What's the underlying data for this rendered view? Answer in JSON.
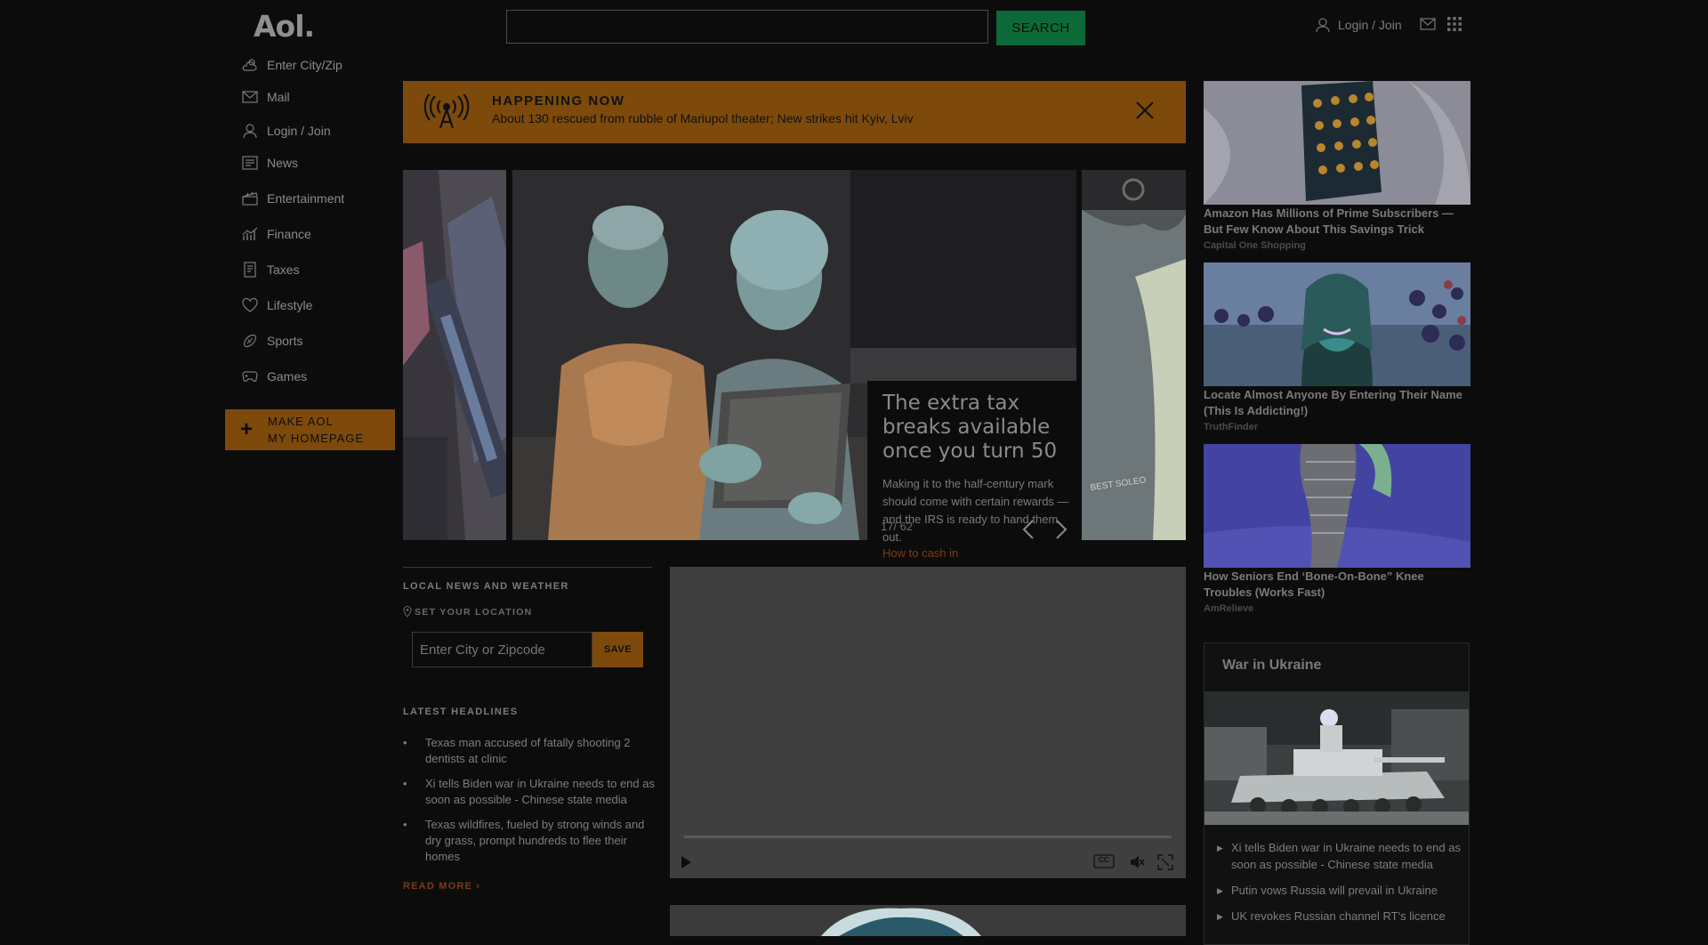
{
  "header": {
    "logo": "Aol.",
    "search_placeholder": "",
    "search_button": "SEARCH",
    "login": "Login / Join"
  },
  "sidebar": {
    "items": [
      {
        "label": "Enter City/Zip",
        "icon": "weather-icon"
      },
      {
        "label": "Mail",
        "icon": "mail-icon"
      },
      {
        "label": "Login / Join",
        "icon": "user-icon"
      },
      {
        "label": "News",
        "icon": "news-icon"
      },
      {
        "label": "Entertainment",
        "icon": "clapper-icon"
      },
      {
        "label": "Finance",
        "icon": "finance-chart-icon"
      },
      {
        "label": "Taxes",
        "icon": "taxes-icon"
      },
      {
        "label": "Lifestyle",
        "icon": "heart-icon"
      },
      {
        "label": "Sports",
        "icon": "football-icon"
      },
      {
        "label": "Games",
        "icon": "gamepad-icon"
      }
    ],
    "make_homepage_line1": "MAKE AOL",
    "make_homepage_line2": "MY HOMEPAGE"
  },
  "banner": {
    "tag": "HAPPENING NOW",
    "text": "About 130 rescued from rubble of Mariupol theater; New strikes hit Kyiv, Lviv"
  },
  "carousel": {
    "title": "The extra tax breaks available once you turn 50",
    "description": "Making it to the half-century mark should come with certain rewards —and the IRS is ready to hand them out.",
    "link": "How to cash in",
    "counter": "17/ 62"
  },
  "local": {
    "heading": "LOCAL NEWS AND WEATHER",
    "set_location": "SET YOUR LOCATION",
    "zip_placeholder": "Enter City or Zipcode",
    "save": "SAVE",
    "latest_heading": "LATEST HEADLINES",
    "headlines": [
      "Texas man accused of fatally shooting 2 dentists at clinic",
      "Xi tells Biden war in Ukraine needs to end as soon as possible - Chinese state media",
      "Texas wildfires, fueled by strong winds and dry grass, prompt hundreds to flee their homes"
    ],
    "read_more": "READ MORE ›"
  },
  "video": {
    "cc_label": "CC"
  },
  "ads": [
    {
      "title": "Amazon Has Millions of Prime Subscribers — But Few Know About This Savings Trick",
      "source": "Capital One Shopping"
    },
    {
      "title": "Locate Almost Anyone By Entering Their Name (This Is Addicting!)",
      "source": "TruthFinder"
    },
    {
      "title": "How Seniors End ‘Bone-On-Bone” Knee Troubles (Works Fast)",
      "source": "AmRelieve"
    }
  ],
  "war": {
    "title": "War in Ukraine",
    "items": [
      "Xi tells Biden war in Ukraine needs to end as soon as possible - Chinese state media",
      "Putin vows Russia will prevail in Ukraine",
      "UK revokes Russian channel RT's licence"
    ]
  },
  "colors": {
    "accent_orange": "#7d4a0c",
    "search_green": "#0b6a37",
    "background": "#0c0c0c"
  }
}
